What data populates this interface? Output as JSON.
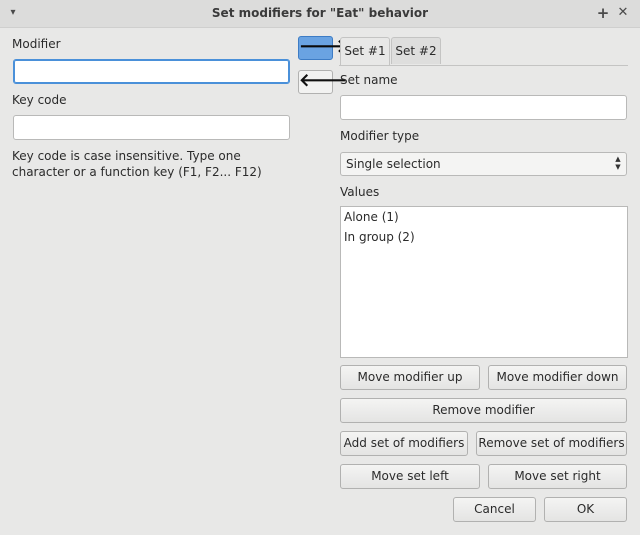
{
  "window": {
    "title": "Set modifiers for \"Eat\" behavior",
    "menu_glyph": "▾",
    "maximize_glyph": "+",
    "close_glyph": "✕"
  },
  "left": {
    "modifier_label": "Modifier",
    "modifier_value": "",
    "keycode_label": "Key code",
    "keycode_value": "",
    "hint": "Key code is case insensitive. Type one character or a function key (F1, F2... F12)"
  },
  "arrows": {
    "right_glyph": "🡒",
    "left_glyph": "🡐"
  },
  "tabs": [
    {
      "label": "Set #1",
      "selected": true
    },
    {
      "label": "Set #2",
      "selected": false
    }
  ],
  "set": {
    "name_label": "Set name",
    "name_value": "",
    "type_label": "Modifier type",
    "type_value": "Single selection",
    "values_label": "Values",
    "values": [
      "Alone (1)",
      "In group (2)"
    ]
  },
  "buttons": {
    "move_up": "Move modifier up",
    "move_down": "Move modifier down",
    "remove_modifier": "Remove modifier",
    "add_set": "Add set of modifiers",
    "remove_set": "Remove set of modifiers",
    "move_left": "Move set left",
    "move_right": "Move set right",
    "cancel": "Cancel",
    "ok": "OK"
  },
  "colors": {
    "accent": "#4a90d9",
    "active_arrow": "#6aa3e2",
    "background": "#e8e8e7"
  }
}
